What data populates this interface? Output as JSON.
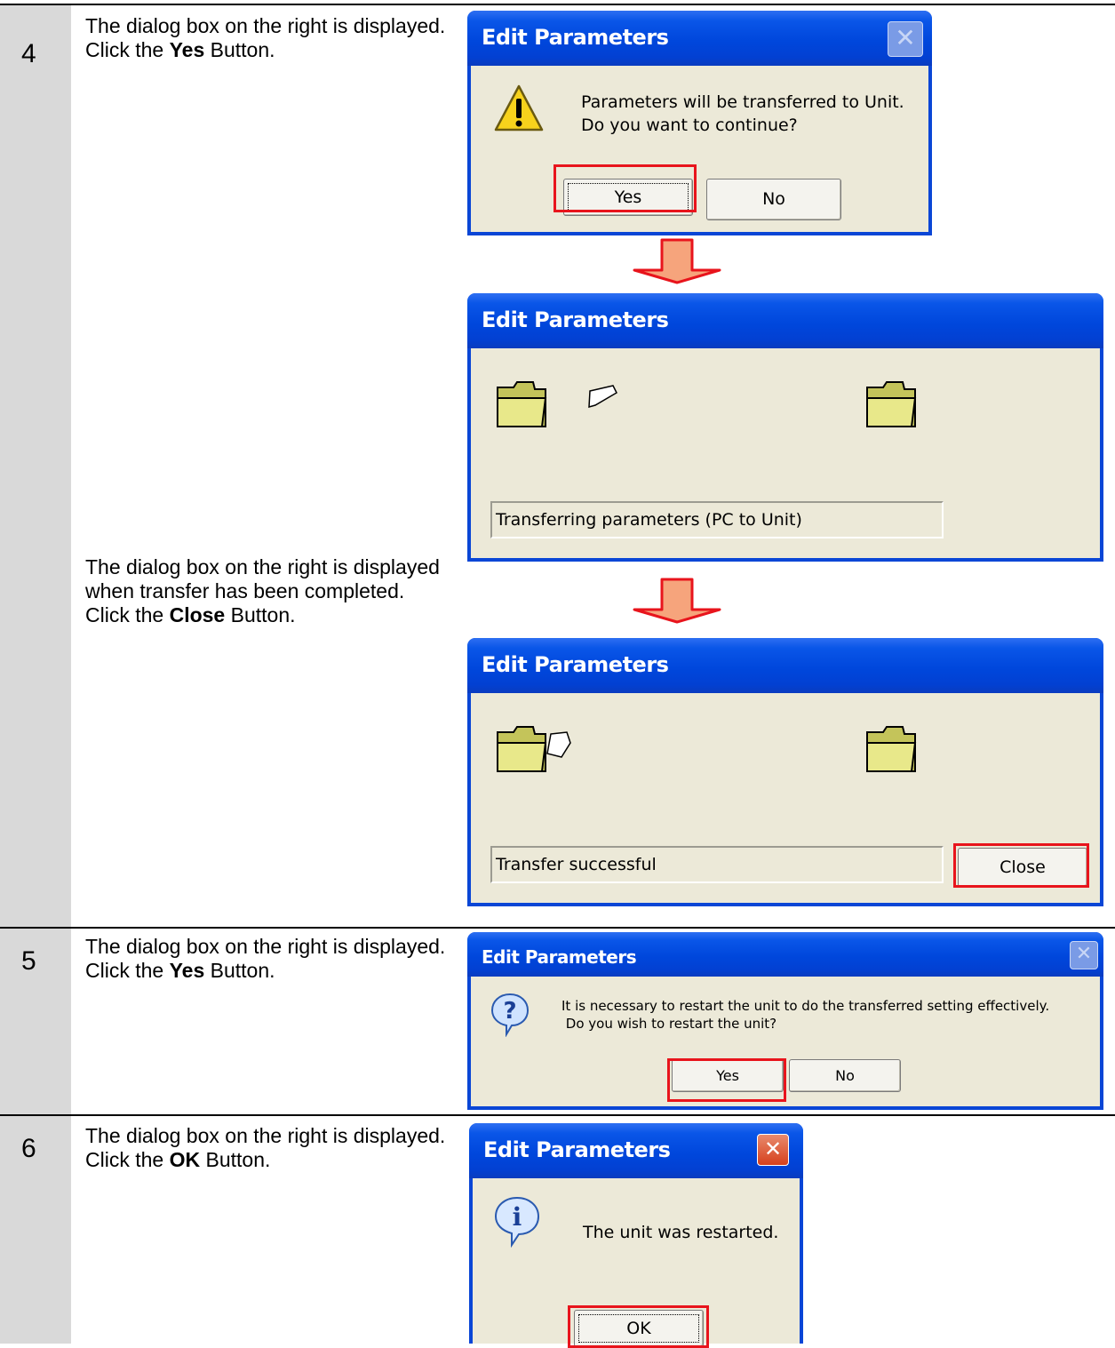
{
  "steps": [
    {
      "number": "4",
      "text_a": "The dialog box on the right is displayed. Click the ",
      "bold_a": "Yes",
      "tail_a": " Button.",
      "text_b": "The dialog box on the right is displayed when transfer has been completed. Click the ",
      "bold_b": "Close",
      "tail_b": " Button."
    },
    {
      "number": "5",
      "text": "The dialog box on the right is displayed. Click the ",
      "bold": "Yes",
      "tail": " Button."
    },
    {
      "number": "6",
      "text": "The dialog box on the right is displayed. Click the ",
      "bold": "OK",
      "tail": " Button."
    }
  ],
  "dialogs": {
    "confirm": {
      "title": "Edit Parameters",
      "line1": "Parameters will be transferred to Unit.",
      "line2": "Do you want to continue?",
      "yes": "Yes",
      "no": "No"
    },
    "transferring": {
      "title": "Edit Parameters",
      "status": "Transferring parameters (PC to Unit)"
    },
    "done": {
      "title": "Edit Parameters",
      "status": "Transfer successful",
      "close": "Close"
    },
    "restart": {
      "title": "Edit Parameters",
      "line1": "It is necessary to restart the unit to do the transferred setting effectively.",
      "line2": " Do you wish to restart the unit?",
      "yes": "Yes",
      "no": "No"
    },
    "restarted": {
      "title": "Edit Parameters",
      "message": "The unit was restarted.",
      "ok": "OK"
    }
  },
  "colors": {
    "highlight": "#e8141c",
    "arrow_fill": "#f6a47c",
    "arrow_stroke": "#e8141c",
    "titlebar": "#0a46d6",
    "dialog_body": "#ece9d8"
  },
  "icons": [
    "warning-icon",
    "folder-icon",
    "paper-icon",
    "question-icon",
    "info-icon",
    "close-icon"
  ]
}
